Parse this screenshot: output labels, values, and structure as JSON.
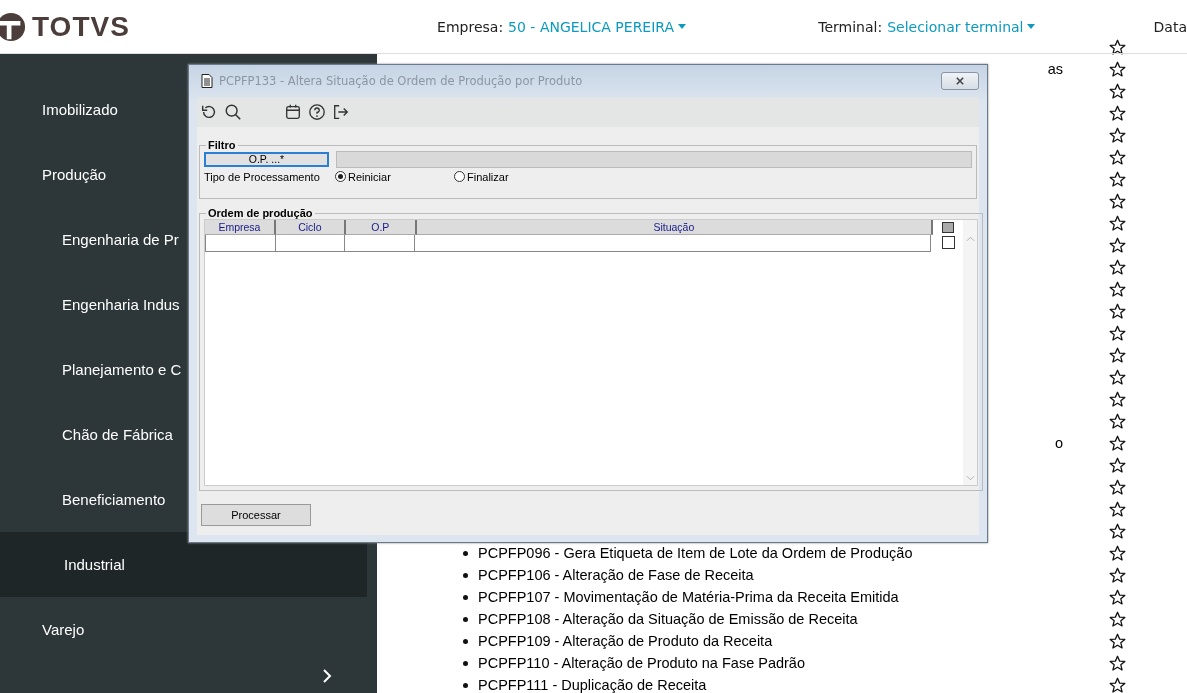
{
  "header": {
    "logo": "TOTVS",
    "empresa_label": "Empresa:",
    "empresa_value": "50 - ANGELICA PEREIRA",
    "terminal_label": "Terminal:",
    "terminal_value": "Selecionar terminal",
    "data_label": "Data"
  },
  "sidebar": {
    "items": [
      {
        "label": "Imobilizado",
        "selected": false
      },
      {
        "label": "Produção",
        "selected": false,
        "children": [
          {
            "label": "Engenharia de Pr",
            "selected": false
          },
          {
            "label": "Engenharia Indus",
            "selected": false
          },
          {
            "label": "Planejamento e C",
            "selected": false
          },
          {
            "label": "Chão de Fábrica",
            "selected": false
          },
          {
            "label": "Beneficiamento",
            "selected": false
          },
          {
            "label": "Industrial",
            "selected": true
          }
        ]
      },
      {
        "label": "Varejo",
        "selected": false
      }
    ]
  },
  "program_list": [
    {
      "kind": "covered"
    },
    {
      "kind": "covered",
      "fragment": "as"
    },
    {
      "kind": "covered"
    },
    {
      "kind": "covered"
    },
    {
      "kind": "covered"
    },
    {
      "kind": "covered"
    },
    {
      "kind": "covered"
    },
    {
      "kind": "covered"
    },
    {
      "kind": "covered"
    },
    {
      "kind": "covered"
    },
    {
      "kind": "covered"
    },
    {
      "kind": "covered"
    },
    {
      "kind": "covered"
    },
    {
      "kind": "covered"
    },
    {
      "kind": "covered"
    },
    {
      "kind": "covered"
    },
    {
      "kind": "covered"
    },
    {
      "kind": "covered"
    },
    {
      "kind": "covered",
      "fragment": "o"
    },
    {
      "kind": "covered"
    },
    {
      "kind": "covered"
    },
    {
      "kind": "covered"
    },
    {
      "kind": "covered"
    },
    {
      "kind": "link",
      "label": "PCPFP096 - Gera Etiqueta de Item de Lote da Ordem de Produção"
    },
    {
      "kind": "link",
      "label": "PCPFP106 - Alteração de Fase de Receita"
    },
    {
      "kind": "link",
      "label": "PCPFP107 - Movimentação de Matéria-Prima da Receita Emitida"
    },
    {
      "kind": "link",
      "label": "PCPFP108 - Alteração da Situação de Emissão de Receita"
    },
    {
      "kind": "link",
      "label": "PCPFP109 - Alteração de Produto da Receita"
    },
    {
      "kind": "link",
      "label": "PCPFP110 - Alteração de Produto na Fase Padrão"
    },
    {
      "kind": "link",
      "label": "PCPFP111 - Duplicação de Receita"
    }
  ],
  "dialog": {
    "title": "PCPFP133 - Altera Situação de Ordem de Produção por Produto",
    "filter": {
      "legend": "Filtro",
      "op_button": "O.P. ...*",
      "tipo_label": "Tipo de Processamento",
      "options": [
        {
          "label": "Reiniciar",
          "selected": true
        },
        {
          "label": "Finalizar",
          "selected": false
        }
      ]
    },
    "orders": {
      "legend": "Ordem de produção",
      "columns": [
        "Empresa",
        "Ciclo",
        "O.P",
        "Situação"
      ],
      "row_checked": false
    },
    "process_button": "Processar"
  }
}
